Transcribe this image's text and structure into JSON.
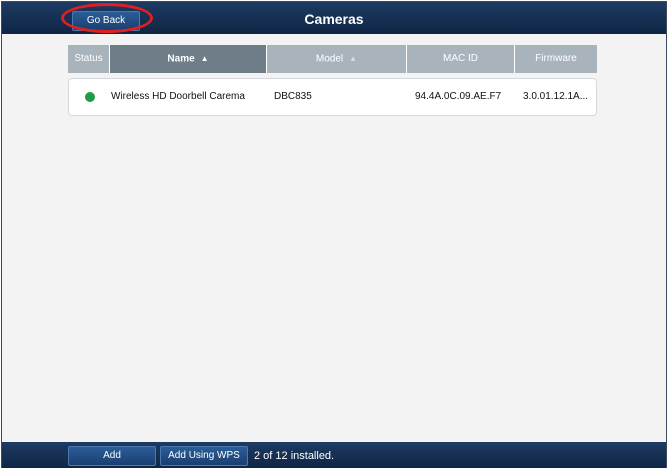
{
  "header": {
    "back_label": "Go Back",
    "title": "Cameras"
  },
  "table": {
    "columns": [
      "Status",
      "Name",
      "Model",
      "MAC ID",
      "Firmware"
    ],
    "sorted_column": "Name",
    "rows": [
      {
        "status": "online",
        "name": "Wireless HD Doorbell Carema",
        "model": "DBC835",
        "mac": "94.4A.0C.09.AE.F7",
        "firmware": "3.0.01.12.1A..."
      }
    ]
  },
  "footer": {
    "add_label": "Add",
    "add_wps_label": "Add Using WPS",
    "installed_text": "2 of 12 installed."
  },
  "colors": {
    "bar": "#1a3558",
    "status_online": "#1f9a45",
    "highlight": "#e02020"
  }
}
